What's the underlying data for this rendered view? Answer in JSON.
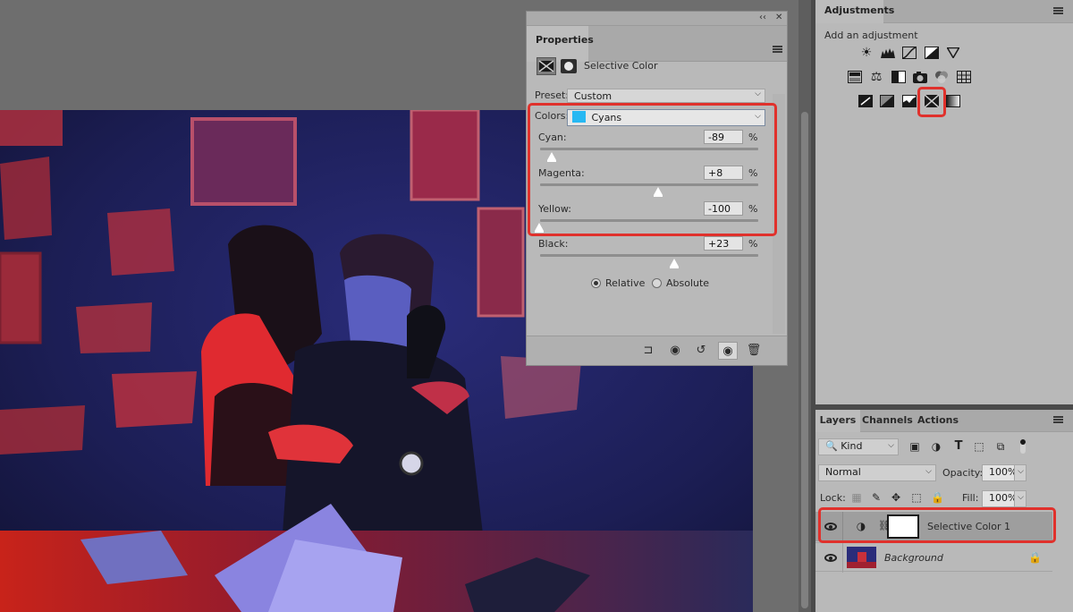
{
  "properties": {
    "tab_label": "Properties",
    "adjustment_title": "Selective Color",
    "preset_label": "Preset:",
    "preset_value": "Custom",
    "colors_label": "Colors:",
    "colors_value": "Cyans",
    "colors_swatch": "#27b8f2",
    "sliders": [
      {
        "label": "Cyan:",
        "value": "-89",
        "unit": "%",
        "position": 0.09
      },
      {
        "label": "Magenta:",
        "value": "+8",
        "unit": "%",
        "position": 0.54
      },
      {
        "label": "Yellow:",
        "value": "-100",
        "unit": "%",
        "position": 0.0
      },
      {
        "label": "Black:",
        "value": "+23",
        "unit": "%",
        "position": 0.61
      }
    ],
    "method_relative": "Relative",
    "method_absolute": "Absolute",
    "method_selected": "Relative",
    "footer_icons": [
      "clip-to-layer-icon",
      "view-previous-state-icon",
      "reset-icon",
      "visibility-icon",
      "trash-icon"
    ]
  },
  "adjustments": {
    "tab_label": "Adjustments",
    "hint": "Add an adjustment",
    "rows": [
      [
        "brightness-contrast-icon",
        "levels-icon",
        "curves-icon",
        "exposure-icon",
        "gradient-triangle-icon"
      ],
      [
        "hue-saturation-icon",
        "color-balance-icon",
        "black-white-icon",
        "photo-filter-icon",
        "channel-mixer-icon",
        "color-lookup-icon"
      ],
      [
        "invert-icon",
        "posterize-icon",
        "threshold-icon",
        "selective-color-icon",
        "gradient-map-icon"
      ]
    ],
    "highlighted": "selective-color-icon"
  },
  "layers": {
    "tabs": [
      "Layers",
      "Channels",
      "Actions"
    ],
    "filter_kind": "Kind",
    "blend_mode": "Normal",
    "opacity_label": "Opacity:",
    "opacity_value": "100%",
    "lock_label": "Lock:",
    "fill_label": "Fill:",
    "fill_value": "100%",
    "items": [
      {
        "name": "Selective Color 1",
        "type": "adjustment",
        "selected": true
      },
      {
        "name": "Background",
        "type": "pixel",
        "locked": true
      }
    ]
  },
  "colors": {
    "highlight_red": "#e0312c",
    "panel_bg": "#b9b9b9",
    "canvas_bg": "#6e6e6e"
  }
}
